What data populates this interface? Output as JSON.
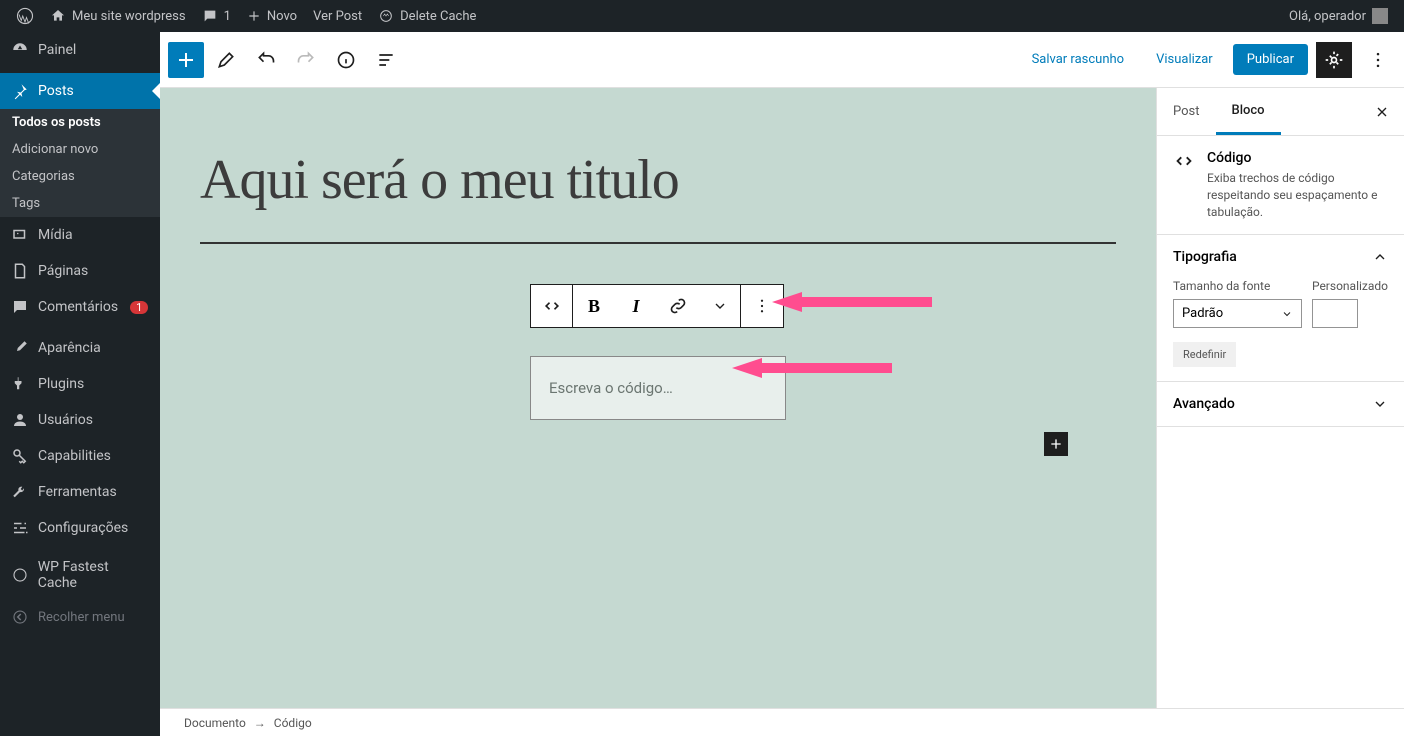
{
  "admin_bar": {
    "site_name": "Meu site wordpress",
    "comments_count": "1",
    "new_label": "Novo",
    "view_post": "Ver Post",
    "delete_cache": "Delete Cache",
    "greeting": "Olá, operador"
  },
  "sidebar": {
    "dashboard": "Painel",
    "posts": "Posts",
    "posts_sub": {
      "all": "Todos os posts",
      "new": "Adicionar novo",
      "categories": "Categorias",
      "tags": "Tags"
    },
    "media": "Mídia",
    "pages": "Páginas",
    "comments": "Comentários",
    "comments_badge": "1",
    "appearance": "Aparência",
    "plugins": "Plugins",
    "users": "Usuários",
    "capabilities": "Capabilities",
    "tools": "Ferramentas",
    "settings": "Configurações",
    "wp_fastest_cache": "WP Fastest Cache",
    "collapse": "Recolher menu"
  },
  "editor_top": {
    "save_draft": "Salvar rascunho",
    "preview": "Visualizar",
    "publish": "Publicar"
  },
  "editor": {
    "title": "Aqui será o meu titulo",
    "code_placeholder": "Escreva o código…"
  },
  "breadcrumb": {
    "document": "Documento",
    "separator": "→",
    "current": "Código"
  },
  "settings_panel": {
    "tab_post": "Post",
    "tab_block": "Bloco",
    "block_title": "Código",
    "block_desc": "Exiba trechos de código respeitando seu espaçamento e tabulação.",
    "typography_header": "Tipografia",
    "font_size_label": "Tamanho da fonte",
    "custom_label": "Personalizado",
    "font_size_value": "Padrão",
    "reset": "Redefinir",
    "advanced": "Avançado"
  }
}
